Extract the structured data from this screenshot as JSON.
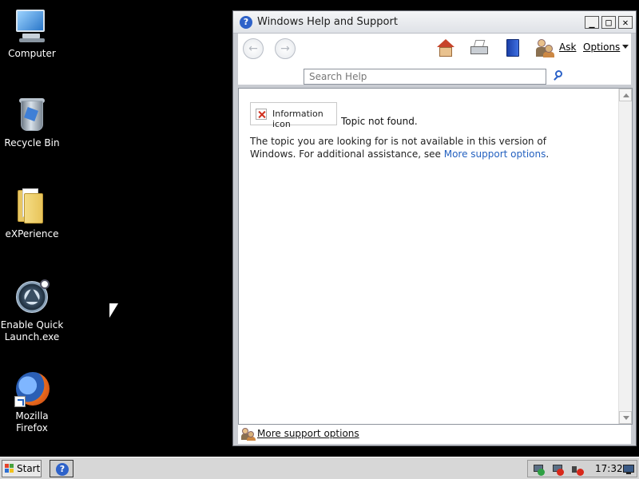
{
  "desktop": {
    "icons": [
      {
        "label": "Computer",
        "icon": "computer-icon"
      },
      {
        "label": "Recycle Bin",
        "icon": "recycle-bin-icon"
      },
      {
        "label": "eXPerience",
        "icon": "folder-icon"
      },
      {
        "label": "Enable Quick Launch.exe",
        "icon": "quick-launch-icon"
      },
      {
        "label": "Mozilla Firefox",
        "icon": "firefox-icon"
      }
    ]
  },
  "window": {
    "title": "Windows Help and Support",
    "controls": {
      "minimize": "_",
      "maximize": "□",
      "close": "✕"
    },
    "toolbar": {
      "back_icon": "←",
      "forward_icon": "→",
      "ask_label": "Ask",
      "options_label": "Options"
    },
    "search": {
      "placeholder": "Search Help",
      "value": ""
    },
    "content": {
      "image_alt": "Information icon",
      "title": "Topic not found.",
      "body_text": "The topic you are looking for is not available in this version of Windows. For additional assistance, see ",
      "link_text": "More support options",
      "body_end": "."
    },
    "status": {
      "support_label": "More support options"
    }
  },
  "taskbar": {
    "start_label": "Start",
    "clock": "17:32"
  }
}
